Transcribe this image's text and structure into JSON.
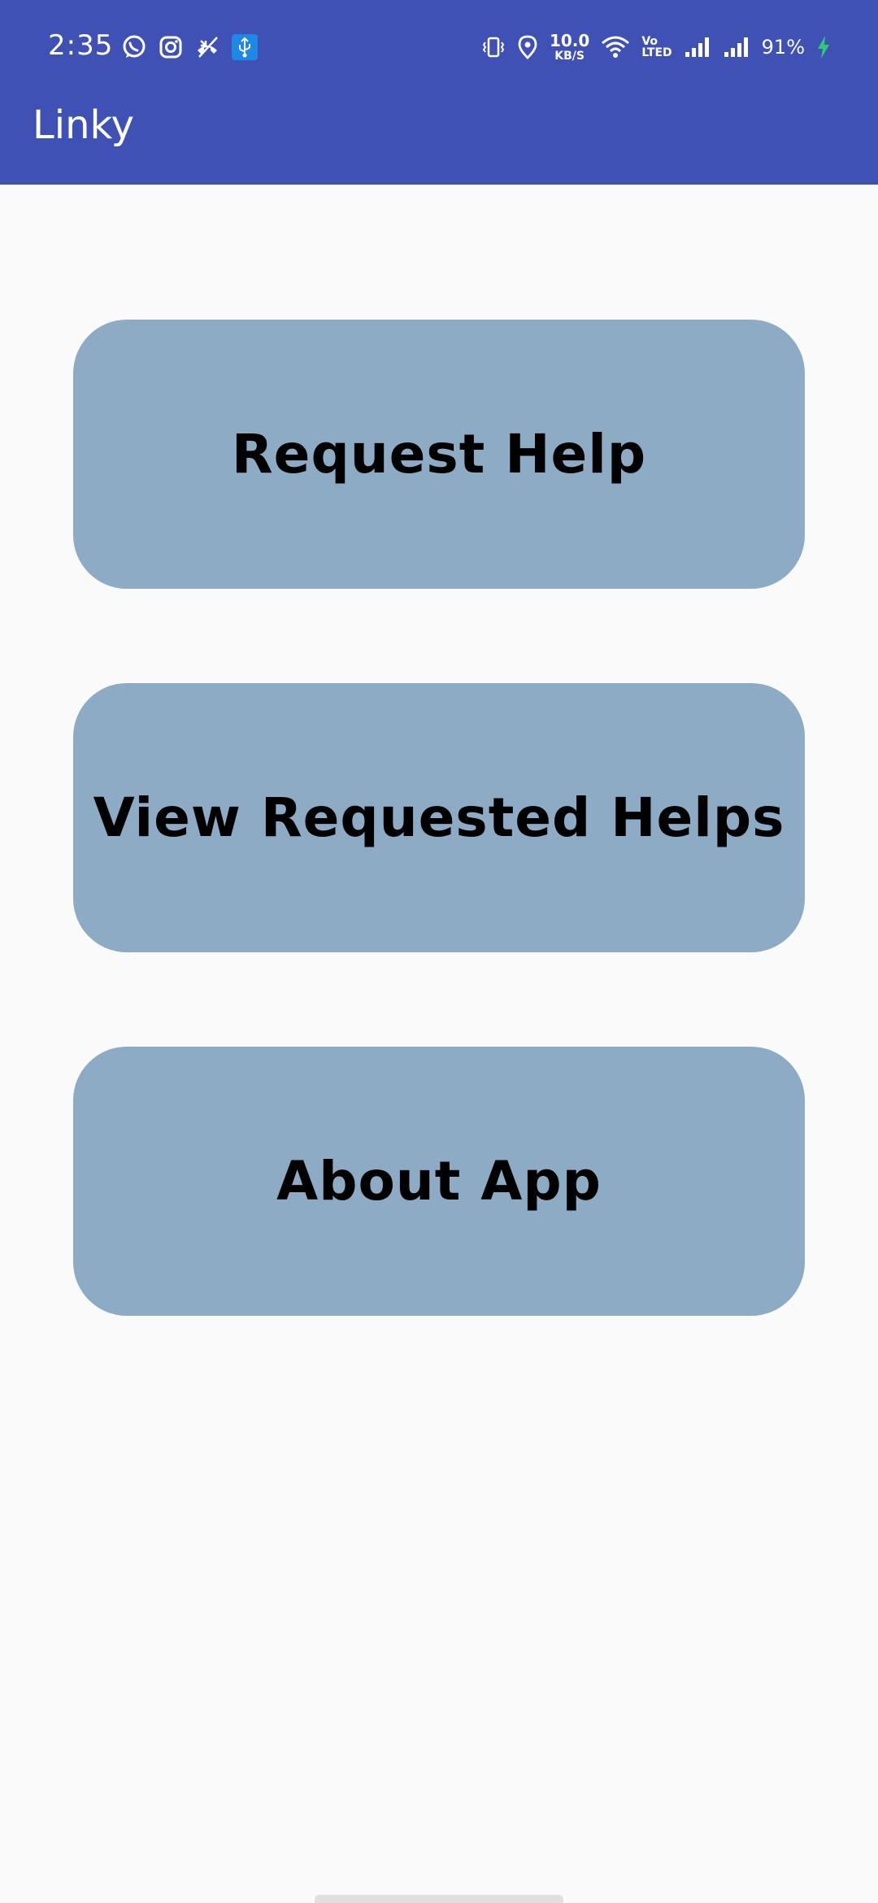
{
  "status_bar": {
    "time": "2:35",
    "left_icons": [
      "whatsapp-icon",
      "instagram-icon",
      "missed-call-icon",
      "usb-icon"
    ],
    "net_speed_value": "10.0",
    "net_speed_unit": "KB/S",
    "volte_top": "Vo",
    "volte_bottom": "LTED",
    "battery_percent": "91%",
    "charging": true
  },
  "app_bar": {
    "title": "Linky",
    "color": "#3F51B5"
  },
  "menu": {
    "button_color": "#8DABC4",
    "buttons": [
      {
        "label": "Request Help"
      },
      {
        "label": "View Requested Helps"
      },
      {
        "label": "About App"
      }
    ]
  },
  "colors": {
    "background": "#FAFAFA",
    "accent_charge": "#2ECC71"
  }
}
